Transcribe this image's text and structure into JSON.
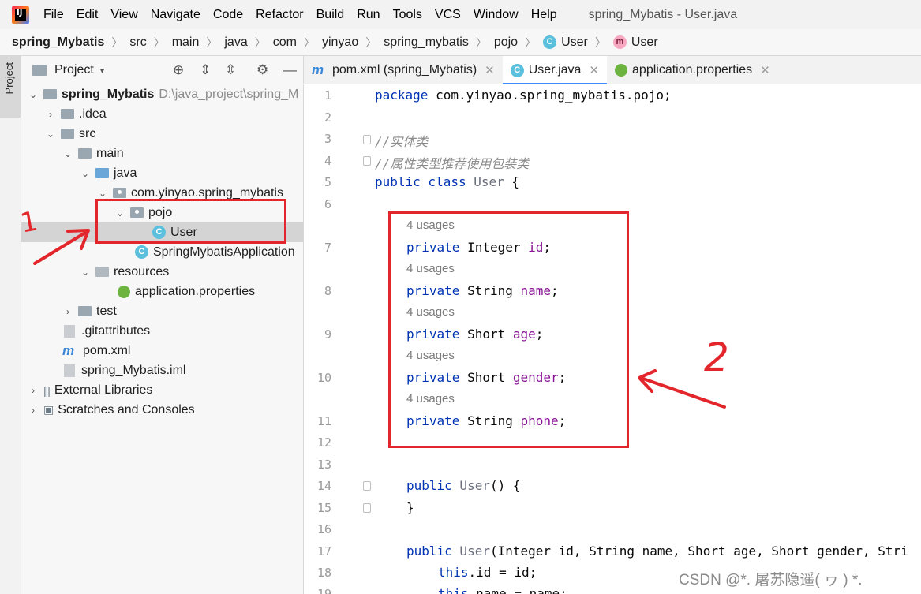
{
  "app": {
    "window_title": "spring_Mybatis - User.java",
    "menu": [
      "File",
      "Edit",
      "View",
      "Navigate",
      "Code",
      "Refactor",
      "Build",
      "Run",
      "Tools",
      "VCS",
      "Window",
      "Help"
    ],
    "menu_underline": [
      "F",
      "E",
      "V",
      "N",
      "C",
      "R",
      "B",
      "R",
      "T",
      "V",
      "W",
      "H"
    ]
  },
  "breadcrumb": [
    "spring_Mybatis",
    "src",
    "main",
    "java",
    "com",
    "yinyao",
    "spring_mybatis",
    "pojo",
    "User",
    "User"
  ],
  "tool_strip": {
    "project_label": "Project"
  },
  "project_panel": {
    "title": "Project",
    "tree": [
      {
        "label": "spring_Mybatis",
        "path": "D:\\java_project\\spring_M"
      },
      {
        "label": ".idea"
      },
      {
        "label": "src"
      },
      {
        "label": "main"
      },
      {
        "label": "java"
      },
      {
        "label": "com.yinyao.spring_mybatis"
      },
      {
        "label": "pojo"
      },
      {
        "label": "User"
      },
      {
        "label": "SpringMybatisApplication"
      },
      {
        "label": "resources"
      },
      {
        "label": "application.properties"
      },
      {
        "label": "test"
      },
      {
        "label": ".gitattributes"
      },
      {
        "label": "pom.xml"
      },
      {
        "label": "spring_Mybatis.iml"
      },
      {
        "label": "External Libraries"
      },
      {
        "label": "Scratches and Consoles"
      }
    ]
  },
  "tabs": [
    {
      "label": "pom.xml (spring_Mybatis)"
    },
    {
      "label": "User.java"
    },
    {
      "label": "application.properties"
    }
  ],
  "editor": {
    "line_numbers": [
      "1",
      "2",
      "3",
      "4",
      "5",
      "6",
      "7",
      "8",
      "9",
      "10",
      "11",
      "12",
      "13",
      "14",
      "15",
      "16",
      "17",
      "18",
      "19"
    ],
    "usages_label": "4 usages",
    "lines": {
      "l1_kw": "package",
      "l1_rest": " com.yinyao.spring_mybatis.pojo;",
      "l3": "//实体类",
      "l4": "//属性类型推荐使用包装类",
      "l5_kw": "public class",
      "l5_cls": " User",
      "l5_rest": " {",
      "f1_kw": "private",
      "f1_type": " Integer ",
      "f1_name": "id",
      "f1_end": ";",
      "f2_kw": "private",
      "f2_type": " String ",
      "f2_name": "name",
      "f2_end": ";",
      "f3_kw": "private",
      "f3_type": " Short ",
      "f3_name": "age",
      "f3_end": ";",
      "f4_kw": "private",
      "f4_type": " Short ",
      "f4_name": "gender",
      "f4_end": ";",
      "f5_kw": "private",
      "f5_type": " String ",
      "f5_name": "phone",
      "f5_end": ";",
      "l14_kw": "public",
      "l14_cls": " User",
      "l14_rest": "() {",
      "l15": "}",
      "l17_kw": "public",
      "l17_cls": " User",
      "l17_rest": "(Integer id, String name, Short age, Short gender, Stri",
      "l18_kw": "this",
      "l18_rest": ".id = id;",
      "l19_kw": "this",
      "l19_rest": ".name = name;"
    }
  },
  "annotations": {
    "mark_1": "1",
    "mark_2": "2",
    "color": "#e3262b"
  },
  "watermark": "CSDN @*. 屠苏隐遥(  ヮ  ) *."
}
